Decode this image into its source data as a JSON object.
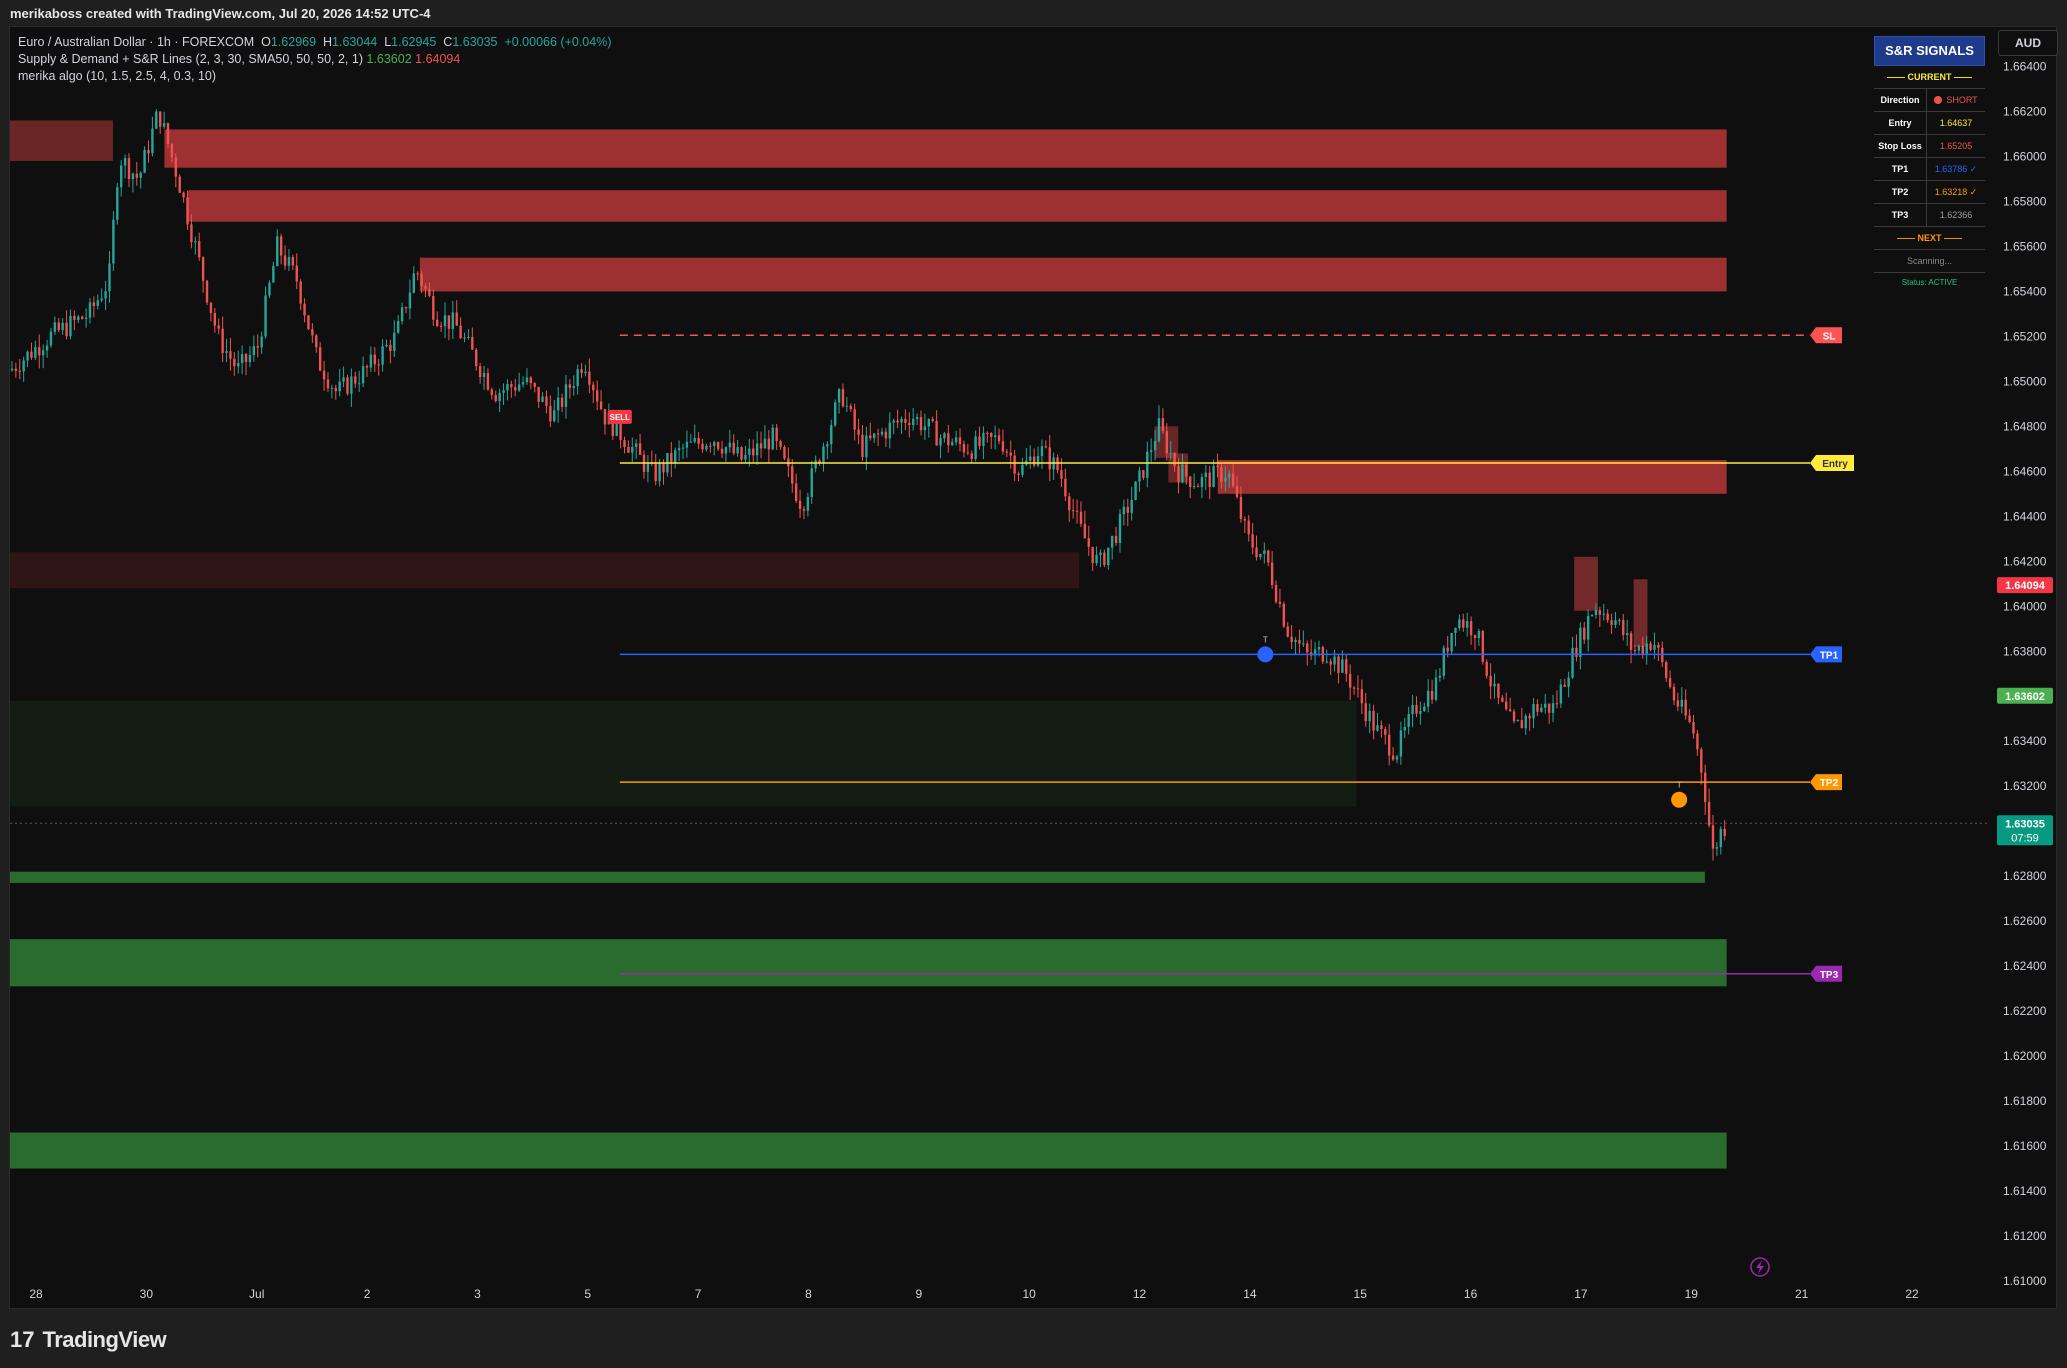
{
  "header": {
    "text": "merikaboss created with TradingView.com, Jul 20, 2026 14:52 UTC-4"
  },
  "legend": {
    "symbol": "Euro / Australian Dollar · 1h · FOREXCOM",
    "o_label": "O",
    "o": "1.62969",
    "h_label": "H",
    "h": "1.63044",
    "l_label": "L",
    "l": "1.62945",
    "c_label": "C",
    "c": "1.63035",
    "chg": "+0.00066 (+0.04%)",
    "ind1": "Supply & Demand + S&R Lines (2, 3, 30, SMA50, 50, 50, 2, 1)",
    "ind1_v1": "1.63602",
    "ind1_v2": "1.64094",
    "ind2": "merika algo (10, 1.5, 2.5, 4, 0.3, 10)"
  },
  "currency": "AUD",
  "footer": {
    "brand": "TradingView",
    "mark": "17"
  },
  "panel": {
    "title": "S&R SIGNALS",
    "current_label": "—— CURRENT ——",
    "rows": [
      {
        "k": "Direction",
        "v": "SHORT",
        "color": "#ef5350",
        "dot": true
      },
      {
        "k": "Entry",
        "v": "1.64637",
        "color": "#ffeb3b"
      },
      {
        "k": "Stop Loss",
        "v": "1.65205",
        "color": "#ef5350"
      },
      {
        "k": "TP1",
        "v": "1.63786 ✓",
        "color": "#2962ff"
      },
      {
        "k": "TP2",
        "v": "1.63218 ✓",
        "color": "#ff9800"
      },
      {
        "k": "TP3",
        "v": "1.62366",
        "color": "#9e9e9e"
      }
    ],
    "next_label": "—— NEXT ——",
    "scanning": "Scanning...",
    "status": "Status: ACTIVE"
  },
  "chart_data": {
    "type": "candlestick",
    "symbol": "EURAUD",
    "timeframe": "1h",
    "y_axis": {
      "range": [
        1.6096,
        1.6658
      ],
      "ticks": [
        "1.66400",
        "1.66200",
        "1.66000",
        "1.65800",
        "1.65600",
        "1.65400",
        "1.65200",
        "1.65000",
        "1.64800",
        "1.64600",
        "1.64400",
        "1.64200",
        "1.64000",
        "1.63800",
        "1.63600",
        "1.63400",
        "1.63200",
        "1.63000",
        "1.62800",
        "1.62600",
        "1.62400",
        "1.62200",
        "1.62000",
        "1.61800",
        "1.61600",
        "1.61400",
        "1.61200",
        "1.61000"
      ]
    },
    "x_axis": {
      "ticks": [
        "28",
        "30",
        "Jul",
        "2",
        "3",
        "5",
        "7",
        "8",
        "9",
        "10",
        "12",
        "14",
        "15",
        "16",
        "17",
        "19",
        "21",
        "22"
      ]
    },
    "price_labels": [
      {
        "value": 1.64094,
        "text": "1.64094",
        "color": "#f23645"
      },
      {
        "value": 1.63602,
        "text": "1.63602",
        "color": "#4caf50"
      },
      {
        "value": 1.63035,
        "text": "1.63035",
        "sub": "07:59",
        "color": "#089981"
      }
    ],
    "levels": [
      {
        "name": "SL",
        "value": 1.65205,
        "color": "#ff5252",
        "style": "dashed"
      },
      {
        "name": "Entry",
        "value": 1.64637,
        "color": "#ffeb3b",
        "style": "solid"
      },
      {
        "name": "TP1",
        "value": 1.63786,
        "color": "#2962ff",
        "style": "solid"
      },
      {
        "name": "TP2",
        "value": 1.63218,
        "color": "#ff9800",
        "style": "solid"
      },
      {
        "name": "TP3",
        "value": 1.62366,
        "color": "#9c27b0",
        "style": "solid"
      }
    ],
    "markers": [
      {
        "text": "SELL",
        "t": 0.308,
        "value": 1.6482,
        "color": "#f23645"
      },
      {
        "text": "T",
        "t": 0.634,
        "value": 1.63786,
        "color": "#2962ff"
      },
      {
        "text": "T",
        "t": 0.843,
        "value": 1.6314,
        "color": "#ff9800"
      }
    ],
    "zones": [
      {
        "t0": 0.0,
        "t1": 0.052,
        "top": 1.6616,
        "bottom": 1.6598,
        "color": "#8a2e2e",
        "opacity": 0.75
      },
      {
        "t0": 0.078,
        "t1": 0.867,
        "top": 1.6612,
        "bottom": 1.6595,
        "color": "#c0393b",
        "opacity": 0.8
      },
      {
        "t0": 0.09,
        "t1": 0.867,
        "top": 1.6585,
        "bottom": 1.6571,
        "color": "#c0393b",
        "opacity": 0.8
      },
      {
        "t0": 0.207,
        "t1": 0.867,
        "top": 1.6555,
        "bottom": 1.654,
        "color": "#c0393b",
        "opacity": 0.8
      },
      {
        "t0": 0.578,
        "t1": 0.59,
        "top": 1.648,
        "bottom": 1.6466,
        "color": "#b23a3a",
        "opacity": 0.55
      },
      {
        "t0": 0.585,
        "t1": 0.595,
        "top": 1.6468,
        "bottom": 1.6455,
        "color": "#b23a3a",
        "opacity": 0.55
      },
      {
        "t0": 0.61,
        "t1": 0.867,
        "top": 1.6465,
        "bottom": 1.645,
        "color": "#c0393b",
        "opacity": 0.8
      },
      {
        "t0": 0.0,
        "t1": 0.54,
        "top": 1.6424,
        "bottom": 1.6408,
        "color": "#4a1c1c",
        "opacity": 0.55
      },
      {
        "t0": 0.79,
        "t1": 0.802,
        "top": 1.6422,
        "bottom": 1.6398,
        "color": "#b23a3a",
        "opacity": 0.6
      },
      {
        "t0": 0.82,
        "t1": 0.827,
        "top": 1.6412,
        "bottom": 1.6382,
        "color": "#b23a3a",
        "opacity": 0.6
      },
      {
        "t0": 0.0,
        "t1": 0.68,
        "top": 1.6358,
        "bottom": 1.6311,
        "color": "#172417",
        "opacity": 0.7
      },
      {
        "t0": 0.0,
        "t1": 0.856,
        "top": 1.6282,
        "bottom": 1.6277,
        "color": "#2e7d32",
        "opacity": 0.85
      },
      {
        "t0": 0.0,
        "t1": 0.867,
        "top": 1.6252,
        "bottom": 1.6231,
        "color": "#2e7d32",
        "opacity": 0.85
      },
      {
        "t0": 0.0,
        "t1": 0.867,
        "top": 1.6166,
        "bottom": 1.615,
        "color": "#2e7d32",
        "opacity": 0.85
      }
    ],
    "price_path": [
      [
        0.0,
        1.6505
      ],
      [
        0.02,
        1.652
      ],
      [
        0.04,
        1.653
      ],
      [
        0.05,
        1.6545
      ],
      [
        0.055,
        1.66
      ],
      [
        0.065,
        1.659
      ],
      [
        0.075,
        1.662
      ],
      [
        0.085,
        1.659
      ],
      [
        0.095,
        1.6555
      ],
      [
        0.105,
        1.652
      ],
      [
        0.115,
        1.6505
      ],
      [
        0.125,
        1.6515
      ],
      [
        0.135,
        1.656
      ],
      [
        0.145,
        1.6545
      ],
      [
        0.155,
        1.651
      ],
      [
        0.165,
        1.6495
      ],
      [
        0.18,
        1.6505
      ],
      [
        0.195,
        1.652
      ],
      [
        0.205,
        1.655
      ],
      [
        0.215,
        1.653
      ],
      [
        0.225,
        1.6525
      ],
      [
        0.235,
        1.651
      ],
      [
        0.245,
        1.6495
      ],
      [
        0.26,
        1.65
      ],
      [
        0.275,
        1.6485
      ],
      [
        0.29,
        1.651
      ],
      [
        0.3,
        1.6485
      ],
      [
        0.31,
        1.6475
      ],
      [
        0.325,
        1.6458
      ],
      [
        0.34,
        1.647
      ],
      [
        0.355,
        1.6475
      ],
      [
        0.37,
        1.6465
      ],
      [
        0.385,
        1.6475
      ],
      [
        0.4,
        1.6445
      ],
      [
        0.41,
        1.647
      ],
      [
        0.42,
        1.6495
      ],
      [
        0.43,
        1.647
      ],
      [
        0.445,
        1.648
      ],
      [
        0.455,
        1.6485
      ],
      [
        0.47,
        1.6475
      ],
      [
        0.485,
        1.647
      ],
      [
        0.5,
        1.6475
      ],
      [
        0.51,
        1.646
      ],
      [
        0.52,
        1.647
      ],
      [
        0.53,
        1.646
      ],
      [
        0.54,
        1.6435
      ],
      [
        0.55,
        1.6418
      ],
      [
        0.56,
        1.6435
      ],
      [
        0.57,
        1.6455
      ],
      [
        0.58,
        1.648
      ],
      [
        0.59,
        1.646
      ],
      [
        0.6,
        1.6455
      ],
      [
        0.615,
        1.646
      ],
      [
        0.625,
        1.643
      ],
      [
        0.635,
        1.642
      ],
      [
        0.645,
        1.639
      ],
      [
        0.655,
        1.6378
      ],
      [
        0.665,
        1.638
      ],
      [
        0.675,
        1.637
      ],
      [
        0.69,
        1.6345
      ],
      [
        0.7,
        1.6335
      ],
      [
        0.71,
        1.6355
      ],
      [
        0.72,
        1.6365
      ],
      [
        0.73,
        1.6395
      ],
      [
        0.74,
        1.639
      ],
      [
        0.75,
        1.636
      ],
      [
        0.76,
        1.6345
      ],
      [
        0.77,
        1.6355
      ],
      [
        0.78,
        1.6355
      ],
      [
        0.79,
        1.638
      ],
      [
        0.8,
        1.64
      ],
      [
        0.81,
        1.6395
      ],
      [
        0.82,
        1.638
      ],
      [
        0.83,
        1.6385
      ],
      [
        0.84,
        1.636
      ],
      [
        0.85,
        1.6345
      ],
      [
        0.855,
        1.6325
      ],
      [
        0.86,
        1.629
      ],
      [
        0.864,
        1.63
      ],
      [
        0.867,
        1.6303
      ]
    ]
  }
}
